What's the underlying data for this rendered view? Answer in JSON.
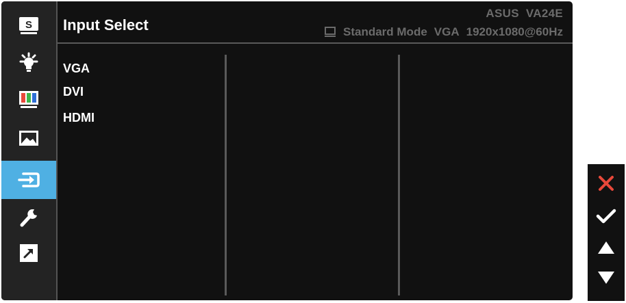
{
  "header": {
    "title": "Input Select",
    "model": "ASUS  VA24E",
    "status": {
      "icon": "monitor-icon",
      "mode": "Standard Mode",
      "input": "VGA",
      "resolution": "1920x1080@60Hz"
    }
  },
  "sidebar": {
    "active_index": 4,
    "accent_color": "#4fb0e3",
    "items": [
      {
        "icon": "splendid-s-icon"
      },
      {
        "icon": "bluelight-bulb-icon"
      },
      {
        "icon": "color-bars-icon"
      },
      {
        "icon": "image-landscape-icon"
      },
      {
        "icon": "input-select-icon"
      },
      {
        "icon": "system-wrench-icon"
      },
      {
        "icon": "shortcut-arrow-icon"
      }
    ]
  },
  "options": [
    "VGA",
    "DVI",
    "HDMI"
  ],
  "keys": [
    {
      "icon": "close-x-icon",
      "color": "#e8483a"
    },
    {
      "icon": "check-icon",
      "color": "#ffffff"
    },
    {
      "icon": "up-triangle-icon",
      "color": "#ffffff"
    },
    {
      "icon": "down-triangle-icon",
      "color": "#ffffff"
    }
  ]
}
